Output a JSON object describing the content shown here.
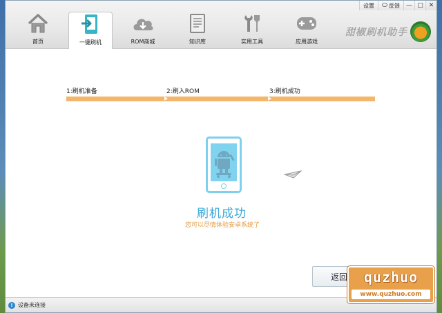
{
  "window": {
    "sys_buttons": {
      "settings_label": "设置",
      "feedback_label": "反馈",
      "minimize_label": "—",
      "maximize_label": "□",
      "close_label": "✕"
    },
    "nav": [
      {
        "label": "首页",
        "icon": "home-icon"
      },
      {
        "label": "一键刷机",
        "icon": "flash-icon"
      },
      {
        "label": "ROM商城",
        "icon": "cloud-download-icon"
      },
      {
        "label": "知识库",
        "icon": "document-icon"
      },
      {
        "label": "实用工具",
        "icon": "tools-icon"
      },
      {
        "label": "应用游戏",
        "icon": "gamepad-icon"
      }
    ],
    "active_nav_index": 1,
    "brand": "甜椒刷机助手"
  },
  "steps": [
    {
      "label": "1:刷机准备"
    },
    {
      "label": "2:刷入ROM"
    },
    {
      "label": "3:刷机成功"
    }
  ],
  "result": {
    "title": "刷机成功",
    "subtitle": "您可以尽情体验安卓系统了"
  },
  "back_button": "返回",
  "status": {
    "text": "设备未连接",
    "icon": "info-icon"
  },
  "watermark": {
    "top": "quzhuo",
    "bottom": "www.quzhuo.com"
  },
  "colors": {
    "progress": "#f4b66a",
    "accent_blue": "#3aa8d8",
    "subtitle_orange": "#e29a3e",
    "nav_icon_gray": "#8a8a8a",
    "active_icon_teal": "#35b5c6"
  }
}
